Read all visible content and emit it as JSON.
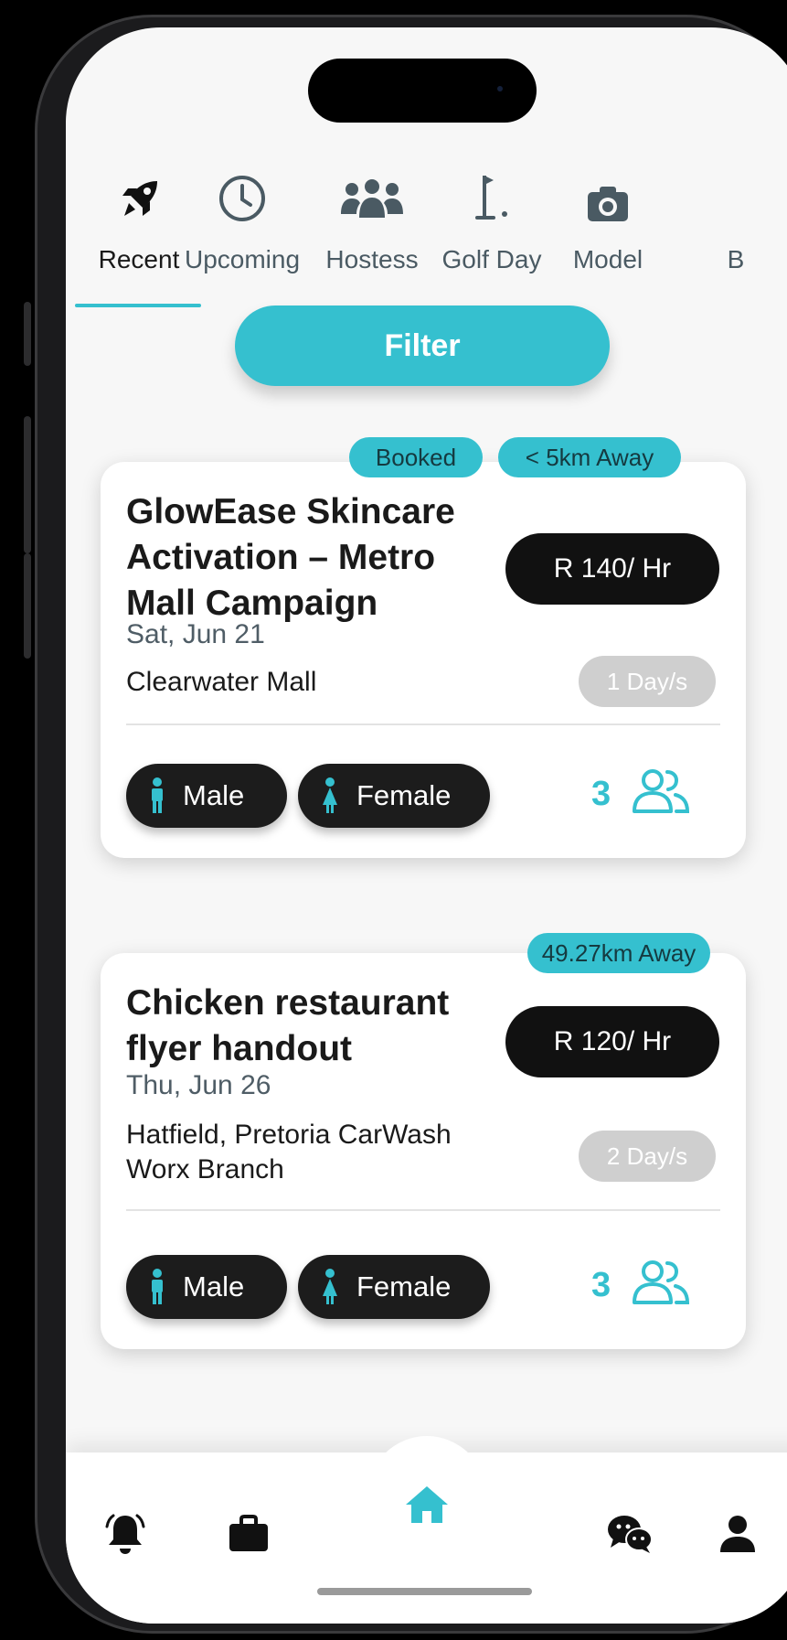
{
  "tabs": [
    {
      "label": "Recent",
      "icon": "rocket-icon",
      "active": true
    },
    {
      "label": "Upcoming",
      "icon": "clock-icon",
      "active": false
    },
    {
      "label": "Hostess",
      "icon": "people-group-icon",
      "active": false
    },
    {
      "label": "Golf Day",
      "icon": "golf-flag-icon",
      "active": false
    },
    {
      "label": "Model",
      "icon": "camera-icon",
      "active": false
    },
    {
      "label": "B",
      "icon": "",
      "active": false
    }
  ],
  "filter": {
    "label": "Filter"
  },
  "jobs": [
    {
      "badges": [
        "Booked",
        "< 5km Away"
      ],
      "title_lines": [
        "GlowEase Skincare",
        "Activation – Metro",
        "Mall Campaign"
      ],
      "price": "R 140/ Hr",
      "date": "Sat, Jun 21",
      "location_lines": [
        "Clearwater Mall"
      ],
      "duration": "1 Day/s",
      "genders": [
        "Male",
        "Female"
      ],
      "count": "3"
    },
    {
      "badges": [
        "49.27km Away"
      ],
      "title_lines": [
        "Chicken restaurant",
        "flyer handout"
      ],
      "price": "R 120/ Hr",
      "date": "Thu, Jun 26",
      "location_lines": [
        "Hatfield, Pretoria CarWash",
        "Worx Branch"
      ],
      "duration": "2 Day/s",
      "genders": [
        "Male",
        "Female"
      ],
      "count": "3"
    }
  ],
  "nav": [
    {
      "name": "notifications",
      "icon": "bell-icon"
    },
    {
      "name": "jobs",
      "icon": "briefcase-icon"
    },
    {
      "name": "home",
      "icon": "home-icon",
      "active": true
    },
    {
      "name": "chat",
      "icon": "chat-icon"
    },
    {
      "name": "profile",
      "icon": "user-icon"
    }
  ],
  "colors": {
    "accent": "#35c0cf",
    "dark": "#111111",
    "muted": "#cfcfcf"
  }
}
